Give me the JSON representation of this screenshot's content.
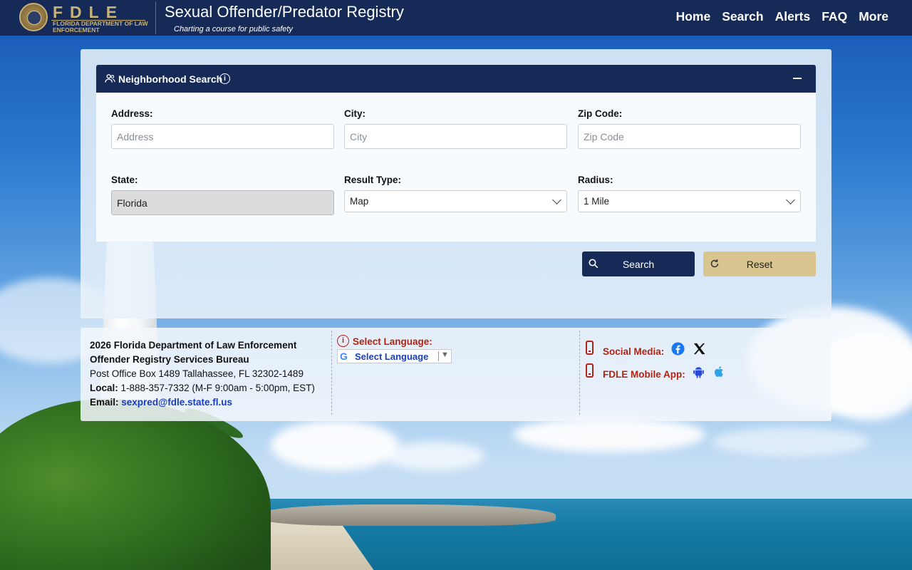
{
  "header": {
    "brand_abbr": "FDLE",
    "brand_full": "Florida Department of Law Enforcement",
    "title": "Sexual Offender/Predator Registry",
    "tagline": "Charting a course for public safety",
    "nav": [
      "Home",
      "Search",
      "Alerts",
      "FAQ",
      "More"
    ]
  },
  "search_panel": {
    "title": "Neighborhood Search",
    "fields": {
      "address": {
        "label": "Address:",
        "placeholder": "Address",
        "value": ""
      },
      "city": {
        "label": "City:",
        "placeholder": "City",
        "value": ""
      },
      "zip": {
        "label": "Zip Code:",
        "placeholder": "Zip Code",
        "value": ""
      },
      "state": {
        "label": "State:",
        "value": "Florida"
      },
      "result_type": {
        "label": "Result Type:",
        "selected": "Map"
      },
      "radius": {
        "label": "Radius:",
        "selected": "1 Mile"
      }
    },
    "buttons": {
      "search": "Search",
      "reset": "Reset"
    }
  },
  "footer": {
    "org_line": "2026 Florida Department of Law Enforcement",
    "bureau": "Offender Registry Services Bureau",
    "address": "Post Office Box 1489 Tallahassee, FL 32302-1489",
    "local_label": "Local:",
    "local_value": " 1-888-357-7332 (M-F 9:00am - 5:00pm, EST)",
    "email_label": "Email:",
    "email": "sexpred@fdle.state.fl.us",
    "language_label": "Select Language:",
    "language_select": "Select Language",
    "social_label": "Social Media:",
    "app_label": "FDLE Mobile App:"
  },
  "colors": {
    "navy": "#162a58",
    "gold": "#d9c590",
    "accent_red": "#b02412",
    "link_blue": "#1a3fb8"
  }
}
